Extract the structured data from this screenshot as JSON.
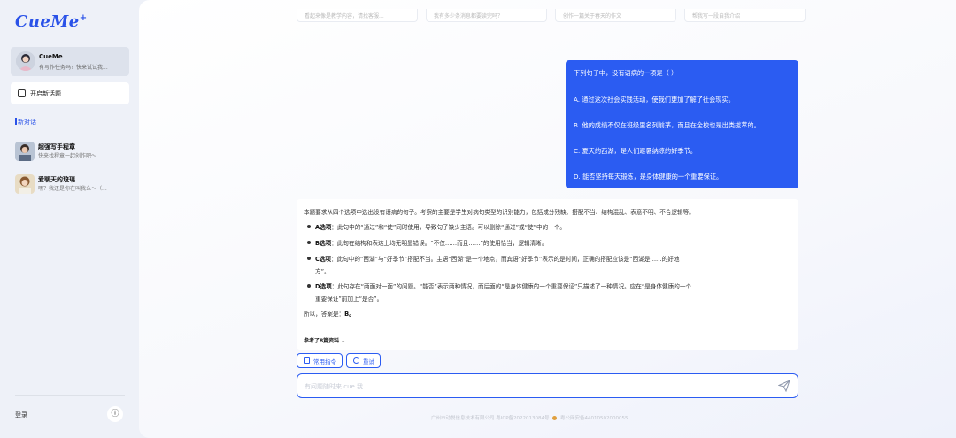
{
  "brand": {
    "logo_text": "CueMe",
    "logo_mark": "+"
  },
  "sidebar": {
    "assistant": {
      "name": "CueMe",
      "subtitle": "有写作任务吗？快来试试我..."
    },
    "new_chat_label": "开启新话题",
    "current_label": "新对话",
    "history": [
      {
        "title": "超强写手程章",
        "subtitle": "快来找程章一起创作吧～"
      },
      {
        "title": "爱聊天的琉璃",
        "subtitle": "嘿？我还是你在叫我么～（..."
      }
    ],
    "login_label": "登录",
    "info_icon": "ⓘ"
  },
  "top_cards": [
    {
      "text": "看起来像是教学内容，请找客服..."
    },
    {
      "text": "我有多少条消息都要读完吗？"
    },
    {
      "text": "创作一篇关于春天的作文"
    },
    {
      "text": "帮我写一段自我介绍"
    }
  ],
  "user_message": {
    "question": "下列句子中，没有语病的一项是（ ）",
    "options": [
      "A. 通过这次社会实践活动，使我们更加了解了社会现实。",
      "B. 他的成绩不仅在班级里名列前茅，而且在全校也是出类拔萃的。",
      "C. 夏天的西湖，是人们避暑纳凉的好季节。",
      "D. 能否坚持每天锻炼，是身体健康的一个重要保证。"
    ]
  },
  "answer": {
    "intro": "本题要求从四个选项中选出没有语病的句子。考察的主要是学生对病句类型的识别能力，包括成分残缺、搭配不当、结构混乱、表意不明、不合逻辑等。",
    "items": [
      {
        "label": "A选项",
        "text": "：此句中的“通过”和“使”同时使用，导致句子缺少主语。可以删除“通过”或“使”中的一个。"
      },
      {
        "label": "B选项",
        "text": "：此句在结构和表达上均无明显错误。“不仅……而且……”的使用恰当，逻辑清晰。"
      },
      {
        "label": "C选项",
        "text": "：此句中的“西湖”与“好季节”搭配不当。主语“西湖”是一个地点，而宾语“好季节”表示的是时间，正确的搭配应该是“西湖是……的好地",
        "text2": "方”。"
      },
      {
        "label": "D选项",
        "text": "：此句存在“两面对一面”的问题。“能否”表示两种情况，而后面的“是身体健康的一个重要保证”只描述了一种情况。应在“是身体健康的一个",
        "text2": "重要保证”前加上“是否”。"
      }
    ],
    "conclusion_prefix": "所以，答案是：",
    "conclusion_value": "B。",
    "references_label": "参考了8篇资料",
    "references_chevron": "⌄"
  },
  "actions": {
    "commands_label": "常用指令",
    "retry_label": "重试"
  },
  "input": {
    "placeholder": "有问题随时来 cue 我",
    "value": ""
  },
  "footer": {
    "company": "广州市动悦信息技术有限公司 粤ICP备2022013084号",
    "police": "粤公网安备44010502000055"
  },
  "colors": {
    "accent": "#2b5cf2",
    "sidebar_bg": "#eef1f8"
  }
}
